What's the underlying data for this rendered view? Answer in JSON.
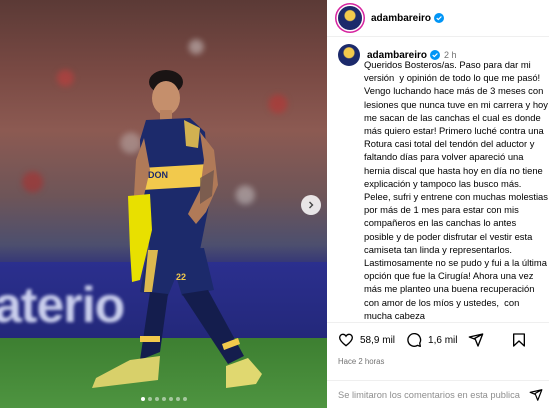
{
  "post": {
    "username": "adambareiro",
    "time": "2 h",
    "caption": "Queridos Bosteros/as. Paso para dar mi versión  y opinión de todo lo que me pasó! Vengo luchando hace más de 3 meses con lesiones que nunca tuve en mi carrera y hoy me sacan de las canchas el cual es donde más quiero estar! Primero luché contra una Rotura casi total del tendón del aductor y faltando días para volver apareció una hernia discal que hasta hoy en día no tiene explicación y tampoco las busco más. Pelee, sufri y entrene con muchas molestias por más de 1 mes para estar con mis compañeros en las canchas lo antes posible y de poder disfrutar el vestir esta camiseta tan linda y representarlos. Lastimosamente no se pudo y fui a la última opción que fue la Cirugía! Ahora una vez más me planteo una buena recuperación con amor de los míos y ustedes,  con mucha cabeza"
  },
  "stats": {
    "likes": "58,9 mil",
    "comments": "1,6 mil",
    "posted_ago": "Hace 2 horas"
  },
  "comments": {
    "disabled_text": "Se limitaron los comentarios en esta publicación."
  },
  "media": {
    "billboard_text": "aterio",
    "jersey_sponsor": "DON",
    "jersey_number": "22",
    "carousel_dots": 7,
    "active_dot": 1
  },
  "icons": {
    "verified": "verified-badge-icon",
    "like": "heart-icon",
    "comment": "comment-bubble-icon",
    "share": "paper-plane-icon",
    "save": "bookmark-icon",
    "next": "chevron-right-icon"
  },
  "colors": {
    "verified": "#0095f6",
    "muted": "#737373",
    "boca_blue": "#1c2a6b",
    "boca_gold": "#f2c94c"
  }
}
